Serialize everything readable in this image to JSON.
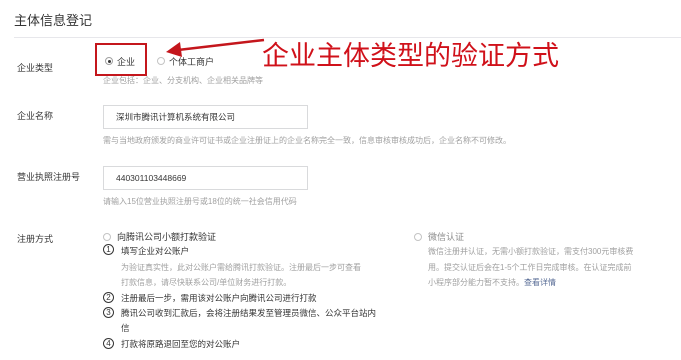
{
  "section": {
    "title": "主体信息登记"
  },
  "annotation": {
    "text": "企业主体类型的验证方式"
  },
  "enterprise_type": {
    "label": "企业类型",
    "options": [
      {
        "label": "企业",
        "selected": true
      },
      {
        "label": "个体工商户",
        "selected": false
      }
    ],
    "hint": "企业包括：企业、分支机构、企业相关品牌等"
  },
  "company_name": {
    "label": "企业名称",
    "value": "深圳市腾讯计算机系统有限公司",
    "hint": "需与当地政府颁发的商业许可证书或企业注册证上的企业名称完全一致，信息审核审核成功后，企业名称不可修改。"
  },
  "license": {
    "label": "营业执照注册号",
    "value": "440301103448669",
    "hint": "请输入15位营业执照注册号或18位的统一社会信用代码"
  },
  "registration": {
    "label": "注册方式",
    "tencent": {
      "label": "向腾讯公司小额打款验证",
      "steps": [
        {
          "num": "1",
          "title": "填写企业对公账户",
          "desc": [
            "为验证真实性，此对公账户需给腾讯打款验证。注册最后一步可查看",
            "打款信息，请尽快联系公司/单位财务进行打款。"
          ]
        },
        {
          "num": "2",
          "title": "注册最后一步，需用该对公账户向腾讯公司进行打款",
          "desc": []
        },
        {
          "num": "3",
          "title": "腾讯公司收到汇款后，会将注册结果发至管理员微信、公众平台站内",
          "title2": "信",
          "desc": []
        },
        {
          "num": "4",
          "title": "打款将原路退回至您的对公账户",
          "desc": []
        }
      ]
    },
    "wechat": {
      "label": "微信认证",
      "desc": [
        "微信注册并认证，无需小额打款验证，需支付300元审核费",
        "用。提交认证后会在1-5个工作日完成审核。在认证完成前",
        "小程序部分能力暂不支持。"
      ],
      "link": "查看详情"
    }
  }
}
